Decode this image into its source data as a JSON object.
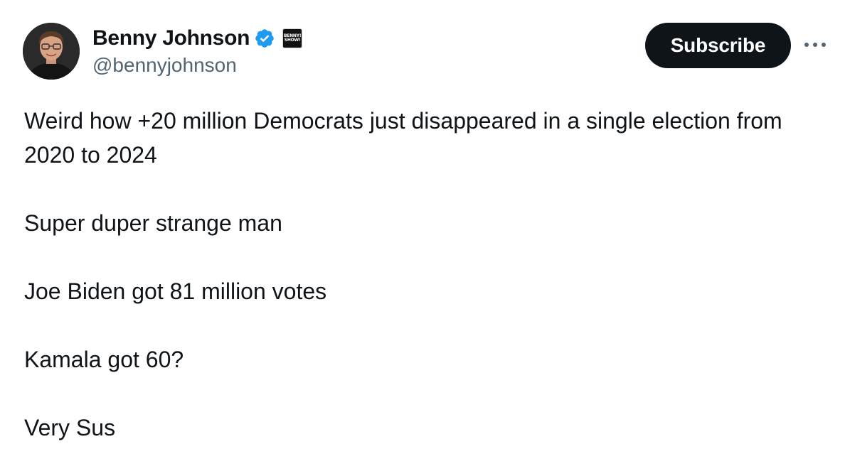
{
  "author": {
    "display_name": "Benny Johnson",
    "handle": "@bennyjohnson",
    "verified_icon": "verified-badge-icon",
    "affiliate_badge_text": "BENNY! SHOW!",
    "avatar": "avatar-photo"
  },
  "actions": {
    "subscribe_label": "Subscribe",
    "more_icon": "more-horizontal-icon"
  },
  "tweet": {
    "lines": [
      "Weird how +20 million Democrats just disappeared in a single election from 2020 to 2024",
      "Super duper strange man",
      "Joe Biden got 81 million votes",
      "Kamala got 60?",
      "Very Sus"
    ]
  },
  "colors": {
    "text_primary": "#0f1419",
    "text_secondary": "#536471",
    "verified_blue": "#1d9bf0",
    "button_bg": "#0f1419",
    "button_text": "#ffffff"
  }
}
